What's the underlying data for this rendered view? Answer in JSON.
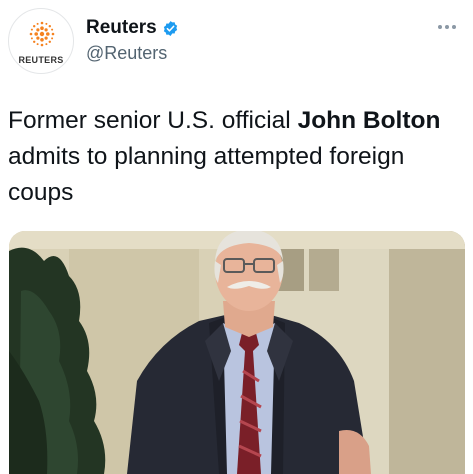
{
  "header": {
    "avatar_label": "REUTERS",
    "display_name": "Reuters",
    "handle": "@Reuters",
    "verified_icon": "verified-badge-icon",
    "more_icon": "more-options-icon"
  },
  "tweet": {
    "text_part1": "Former senior U.S. official ",
    "text_bold": "John Bolton",
    "text_part2": " admits to planning attempted foreign coups"
  },
  "media": {
    "alt_icon": "photo"
  },
  "colors": {
    "accent": "#1d9bf0",
    "reuters_orange": "#f58220",
    "text": "#0f1419",
    "secondary": "#536471"
  }
}
